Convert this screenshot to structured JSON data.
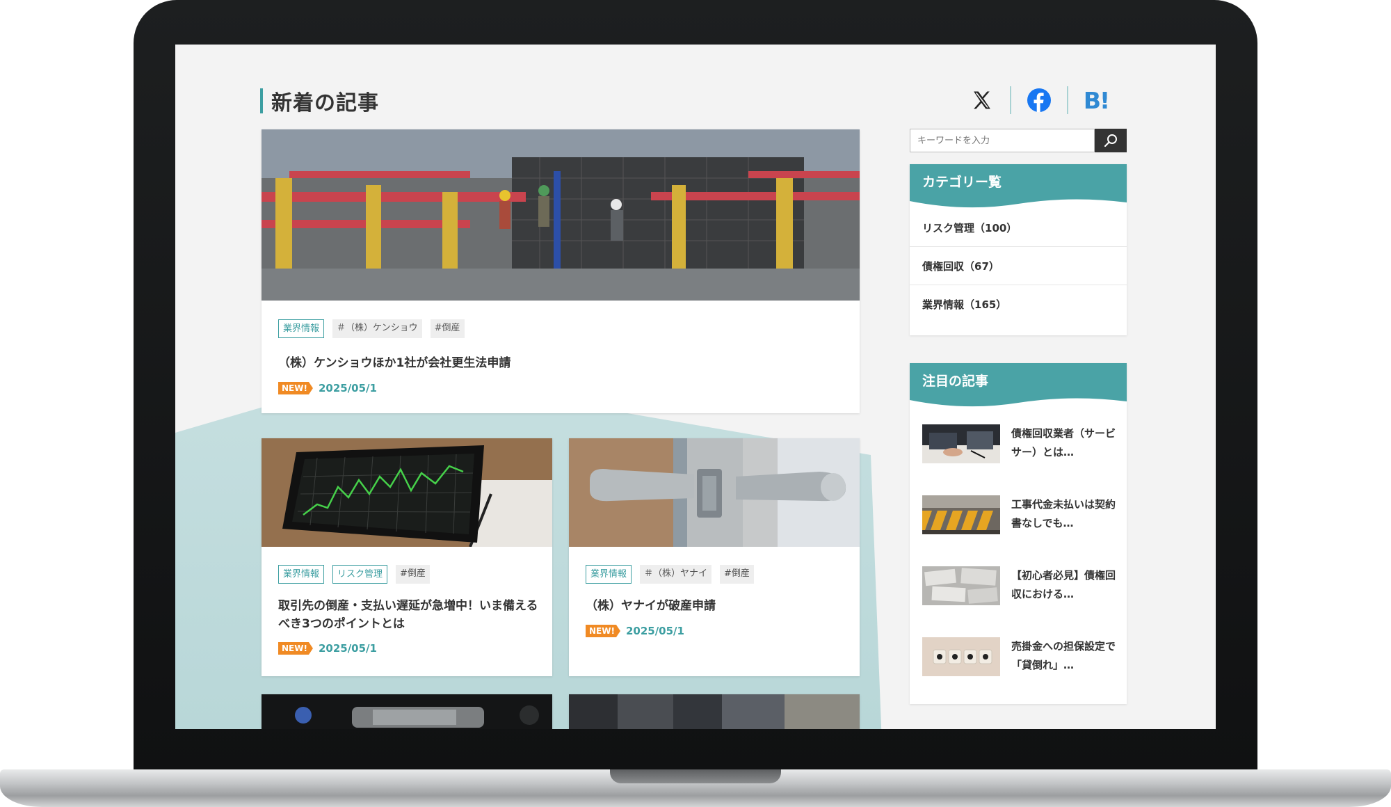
{
  "page": {
    "title": "新着の記事"
  },
  "social": {
    "x": "X",
    "facebook": "Facebook",
    "hatena": "B!"
  },
  "search": {
    "placeholder": "キーワードを入力"
  },
  "badge": {
    "new": "NEW!"
  },
  "articles": [
    {
      "tags": [
        "業界情報",
        "＃（株）ケンショウ",
        "#倒産"
      ],
      "title": "（株）ケンショウほか1社が会社更生法申請",
      "date": "2025/05/1"
    },
    {
      "tags": [
        "業界情報",
        "リスク管理",
        "#倒産"
      ],
      "title": "取引先の倒産・支払い遅延が急増中！いま備えるべき3つのポイントとは",
      "date": "2025/05/1"
    },
    {
      "tags": [
        "業界情報",
        "＃（株）ヤナイ",
        "#倒産"
      ],
      "title": "（株）ヤナイが破産申請",
      "date": "2025/05/1"
    }
  ],
  "sidebar": {
    "categories": {
      "title": "カテゴリー覧",
      "items": [
        "リスク管理（100）",
        "債権回収（67）",
        "業界情報（165）"
      ]
    },
    "featured": {
      "title": "注目の記事",
      "items": [
        "債権回収業者（サービサー）とは…",
        "工事代金未払いは契約書なしでも…",
        "【初心者必見】債権回収における…",
        "売掛金への担保設定で「貸倒れ」…"
      ]
    }
  },
  "colors": {
    "accent": "#3c9ea1",
    "widget_head": "#4aa3a6",
    "new_badge": "#f08a24",
    "hatena": "#2f89d3",
    "facebook": "#1877f2"
  }
}
